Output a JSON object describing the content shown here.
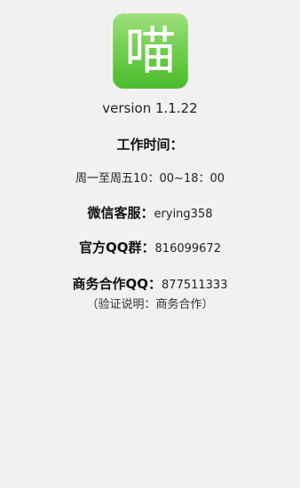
{
  "app": {
    "icon_char": "喵",
    "icon_colors": {
      "top": "#9ee07d",
      "bottom": "#4bbb2e"
    },
    "version": "version 1.1.22"
  },
  "work_hours": {
    "title": "工作时间：",
    "value": "周一至周五10：00~18：00"
  },
  "contacts": {
    "wechat_label": "微信客服：",
    "wechat_value": "erying358",
    "qq_group_label": "官方QQ群：",
    "qq_group_value": "816099672",
    "business_label": "商务合作QQ：",
    "business_value": "877511333",
    "business_note": "（验证说明：商务合作）"
  }
}
